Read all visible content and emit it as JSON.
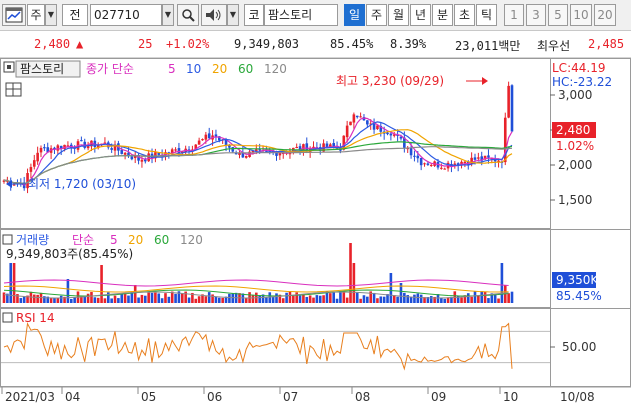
{
  "toolbar": {
    "chart_type_icon": "window-chart-icon",
    "chart_type": "주",
    "prev_label": "전",
    "code": "027710",
    "search_icon": "magnifier-icon",
    "speaker_icon": "speaker-icon",
    "market": "코",
    "stock_name": "팜스토리",
    "periods": [
      "일",
      "주",
      "월",
      "년",
      "분",
      "초",
      "틱"
    ],
    "selected_period": "일",
    "intervals": [
      "1",
      "3",
      "5",
      "10",
      "20"
    ]
  },
  "quote": {
    "price": "2,480",
    "arrow": "▲",
    "change": "25",
    "rate": "+1.02%",
    "volume": "9,349,803",
    "vol_ratio": "85.45%",
    "turnover": "8.39%",
    "amount": "23,011백만",
    "best_ask_label": "최우선",
    "best_ask": "2,485"
  },
  "price_panel": {
    "name": "팜스토리",
    "legend_title": "종가 단순",
    "ma": [
      "5",
      "10",
      "20",
      "60",
      "120"
    ],
    "high_note": "최고 3,230 (09/29)",
    "low_note": "최저 1,720 (03/10)",
    "lc": "LC:44.19",
    "hc": "HC:-23.22",
    "y_ticks": [
      "3,000",
      "2,500",
      "2,000",
      "1,500"
    ],
    "current_price": "2,480",
    "current_rate": "1.02%"
  },
  "volume_panel": {
    "title": "거래량",
    "legend_title": "단순",
    "ma": [
      "5",
      "20",
      "60",
      "120"
    ],
    "info": "9,349,803주(85.45%)",
    "current": "9,350K",
    "current_rate": "85.45%"
  },
  "rsi_panel": {
    "title": "RSI 14",
    "y_tick": "50.00"
  },
  "x_axis": [
    "2021/03",
    "04",
    "05",
    "06",
    "07",
    "08",
    "09",
    "10"
  ],
  "x_axis_right": "10/08",
  "colors": {
    "up": "#e8222a",
    "down": "#1f4fd8",
    "ma5": "#d92fbe",
    "ma10": "#2d5be3",
    "ma20": "#f0a400",
    "ma60": "#2aa83a",
    "ma120": "#8a8a8a",
    "rsi": "#e87f1e"
  }
}
